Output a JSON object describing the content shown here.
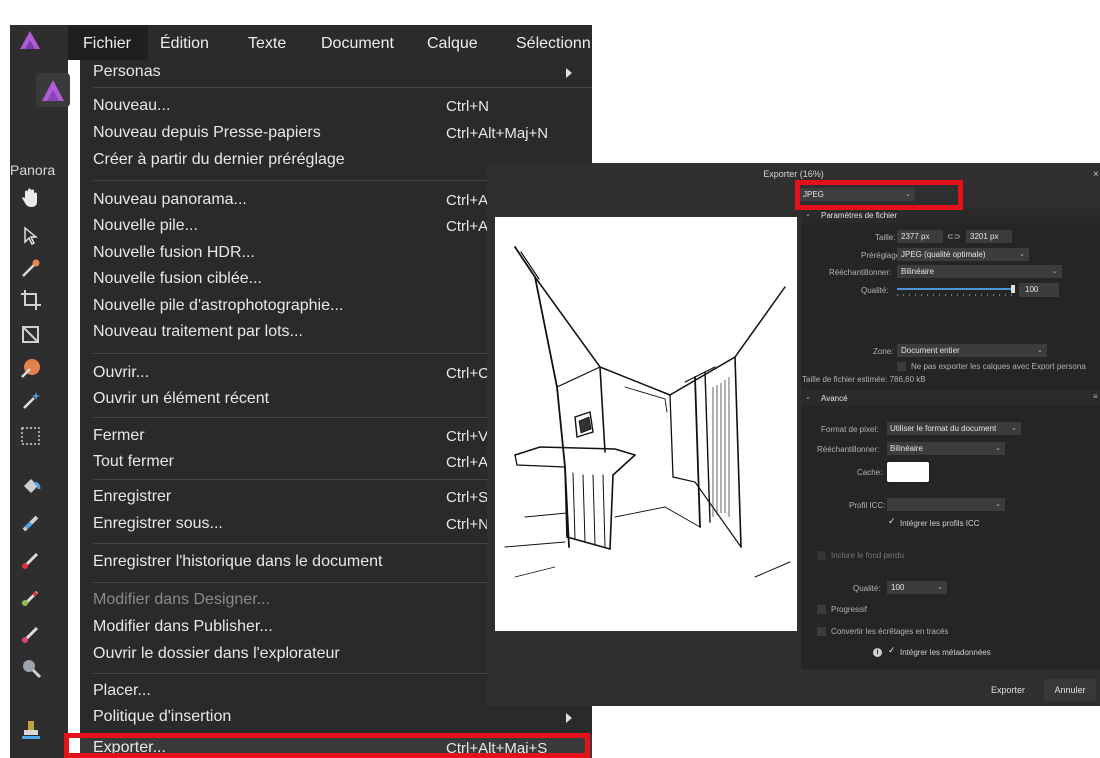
{
  "toolbar": {
    "persona_label": "Panora",
    "icons": [
      "hand-icon",
      "move-arrow-icon",
      "color-picker-icon",
      "crop-icon",
      "selection-brush-icon",
      "magic-wand-icon",
      "marquee-icon",
      "flood-fill-icon",
      "brush-icon",
      "paint-brush-icon",
      "mixer-brush-icon",
      "eraser-icon",
      "zoom-icon",
      "clone-stamp-icon"
    ]
  },
  "menubar": {
    "items": [
      "Fichier",
      "Édition",
      "Texte",
      "Document",
      "Calque",
      "Sélectionn"
    ]
  },
  "menu": {
    "personas": "Personas",
    "nouveau": "Nouveau...",
    "nouveau_sc": "Ctrl+N",
    "presse_papiers": "Nouveau depuis Presse-papiers",
    "presse_papiers_sc": "Ctrl+Alt+Maj+N",
    "preglage": "Créer à partir du dernier préréglage",
    "panorama": "Nouveau panorama...",
    "panorama_sc": "Ctrl+A",
    "pile": "Nouvelle pile...",
    "pile_sc": "Ctrl+A",
    "hdr": "Nouvelle fusion HDR...",
    "ciblee": "Nouvelle fusion ciblée...",
    "astro": "Nouvelle pile d'astrophotographie...",
    "lots": "Nouveau traitement par lots...",
    "ouvrir": "Ouvrir...",
    "ouvrir_sc": "Ctrl+C",
    "recent": "Ouvrir un élément récent",
    "fermer": "Fermer",
    "fermer_sc": "Ctrl+V",
    "tout_fermer": "Tout fermer",
    "tout_fermer_sc": "Ctrl+A",
    "enregistrer": "Enregistrer",
    "enregistrer_sc": "Ctrl+S",
    "enregistrer_sous": "Enregistrer sous...",
    "enregistrer_sous_sc": "Ctrl+N",
    "historique": "Enregistrer l'historique dans le document",
    "designer": "Modifier dans Designer...",
    "publisher": "Modifier dans Publisher...",
    "explorateur": "Ouvrir le dossier dans l'explorateur",
    "placer": "Placer...",
    "politique": "Politique d'insertion",
    "exporter": "Exporter...",
    "exporter_sc": "Ctrl+Alt+Maj+S"
  },
  "dialog": {
    "title": "Exporter (16%)",
    "close": "×",
    "format": "JPEG",
    "section_fichier": "Paramètres de fichier",
    "taille_label": "Taille:",
    "width": "2377 px",
    "height": "3201 px",
    "prereglage_label": "Préréglage:",
    "prereglage": "JPEG (qualité optimale)",
    "reech_label": "Rééchantillonner:",
    "reech": "Bilinéaire",
    "qualite_label": "Qualité:",
    "qualite": "100",
    "qualite_level": 1.0,
    "zone_label": "Zone:",
    "zone": "Document entier",
    "export_persona": "Ne pas exporter les calques avec Export persona",
    "taille_fichier": "Taille de fichier estimée: 786,60 kB",
    "section_avance": "Avancé",
    "pixel_label": "Format de pixel:",
    "pixel": "Utiliser le format du document",
    "reech2_label": "Rééchantillonner:",
    "reech2": "Bilinéaire",
    "cache_label": "Cache:",
    "icc_label": "Profil ICC:",
    "integrer_icc": "Intégrer les profils ICC",
    "fond_perdu": "Inclure le fond perdu",
    "qualite2_label": "Qualité:",
    "qualite2": "100",
    "progressif": "Progressif",
    "ecretages": "Convertir les écrêtages en tracés",
    "metadonnees": "Intégrer les métadonnées",
    "btn_export": "Exporter",
    "btn_cancel": "Annuler"
  }
}
